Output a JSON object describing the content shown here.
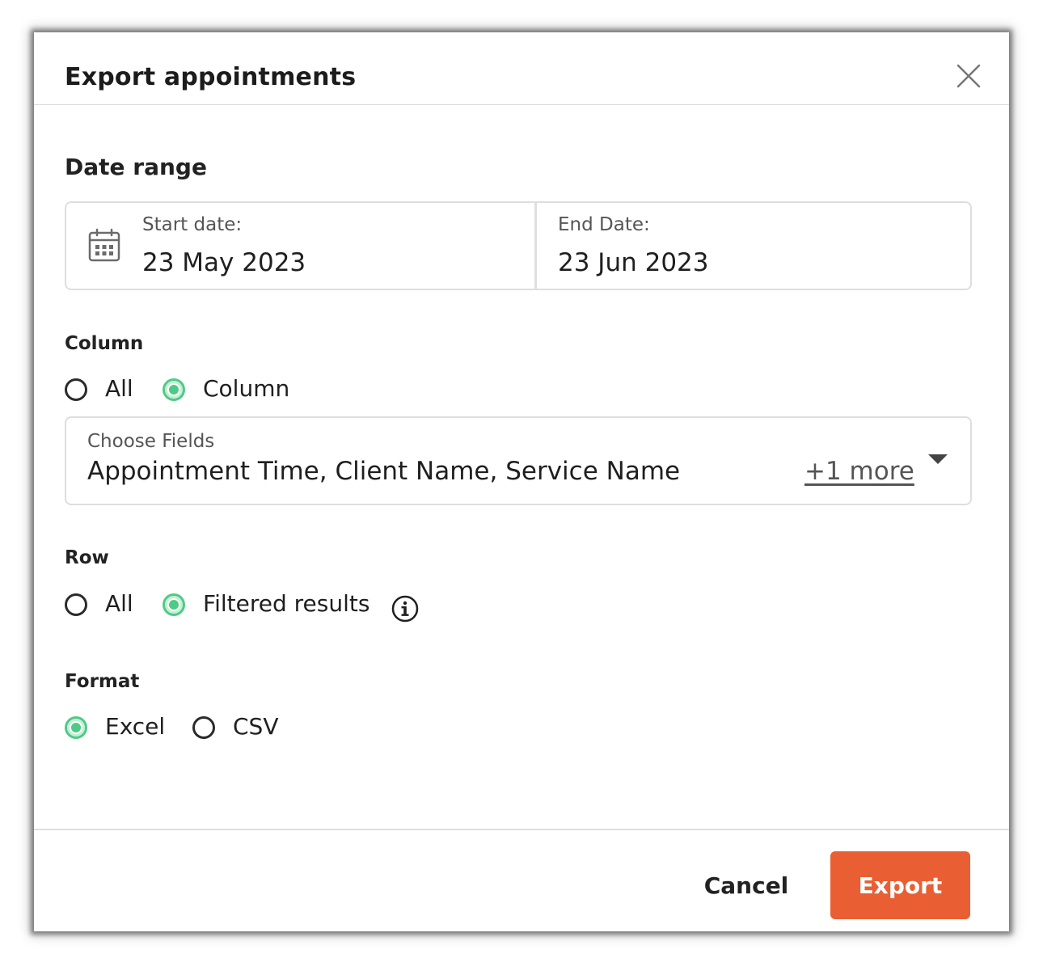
{
  "dialog": {
    "title": "Export appointments",
    "close_icon": "close-icon"
  },
  "date_range": {
    "heading": "Date range",
    "icon": "calendar-icon",
    "start_label": "Start date:",
    "start_value": "23 May 2023",
    "end_label": "End Date:",
    "end_value": "23 Jun 2023"
  },
  "column": {
    "heading": "Column",
    "options": [
      {
        "label": "All",
        "selected": false
      },
      {
        "label": "Column",
        "selected": true
      }
    ],
    "fields": {
      "caption": "Choose Fields",
      "value": "Appointment Time, Client Name, Service Name",
      "more": "+1 more",
      "icon": "chevron-down-icon"
    }
  },
  "row": {
    "heading": "Row",
    "options": [
      {
        "label": "All",
        "selected": false
      },
      {
        "label": "Filtered results",
        "selected": true
      }
    ],
    "info_icon": "info-icon"
  },
  "format": {
    "heading": "Format",
    "options": [
      {
        "label": "Excel",
        "selected": true
      },
      {
        "label": "CSV",
        "selected": false
      }
    ]
  },
  "footer": {
    "cancel": "Cancel",
    "export": "Export"
  },
  "colors": {
    "accent_green": "#4fca86",
    "export_button": "#e95f33",
    "border": "#dedede"
  }
}
